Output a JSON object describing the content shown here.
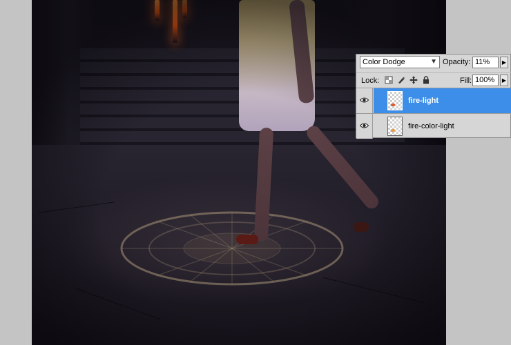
{
  "canvas": {
    "description_icon": "artwork-canvas"
  },
  "layers_panel": {
    "blend_mode": "Color Dodge",
    "opacity_label": "Opacity:",
    "opacity_value": "11%",
    "lock_label": "Lock:",
    "fill_label": "Fill:",
    "fill_value": "100%",
    "layers": [
      {
        "name": "fire-light",
        "selected": true,
        "visible": true
      },
      {
        "name": "fire-color-light",
        "selected": false,
        "visible": true
      }
    ],
    "colors": {
      "selection": "#3d8ee8",
      "panel_bg": "#d6d6d6"
    }
  }
}
